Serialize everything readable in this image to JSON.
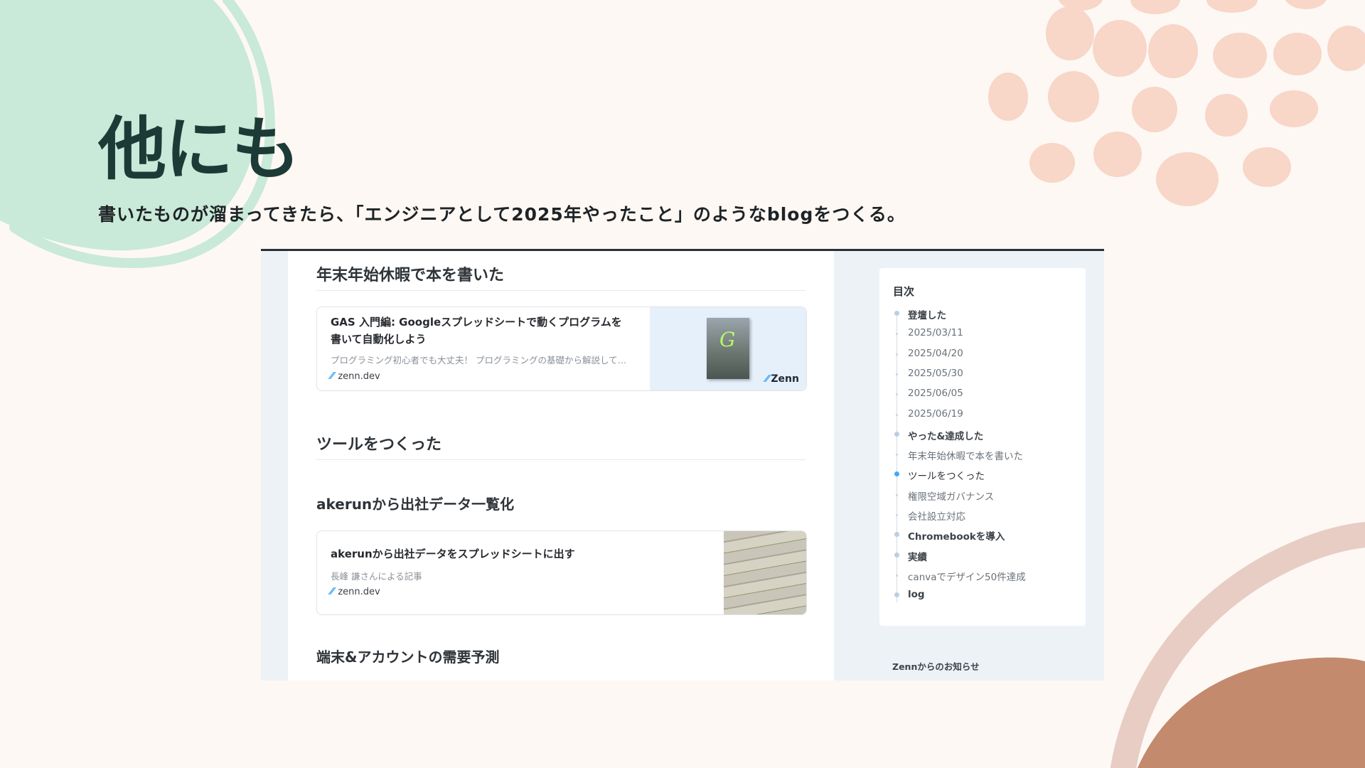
{
  "slide": {
    "title": "他にも",
    "subtitle": "書いたものが溜まってきたら、「エンジニアとして2025年やったこと」のようなblogをつくる。"
  },
  "article": {
    "section1_heading": "年末年始休暇で本を書いた",
    "card1": {
      "title_line1": "GAS 入門編: Googleスプレッドシートで動くプログラムを",
      "title_line2": "書いて自動化しよう",
      "description": "プログラミング初心者でも大丈夫！ プログラミングの基礎から解説して…",
      "domain": "zenn.dev",
      "logo_text": "Zenn",
      "thumb_letter": "G"
    },
    "section2_heading": "ツールをつくった",
    "subsection_heading": "akerunから出社データ一覧化",
    "card2": {
      "title": "akerunから出社データをスプレッドシートに出す",
      "description": "長峰 謙さんによる記事",
      "domain": "zenn.dev"
    },
    "section3_heading": "端末&アカウントの需要予測"
  },
  "toc": {
    "title": "目次",
    "items": [
      {
        "label": "登壇した",
        "level": 1
      },
      {
        "label": "2025/03/11",
        "level": 2
      },
      {
        "label": "2025/04/20",
        "level": 2
      },
      {
        "label": "2025/05/30",
        "level": 2
      },
      {
        "label": "2025/06/05",
        "level": 2
      },
      {
        "label": "2025/06/19",
        "level": 2
      },
      {
        "label": "やった&達成した",
        "level": 1
      },
      {
        "label": "年末年始休暇で本を書いた",
        "level": 2
      },
      {
        "label": "ツールをつくった",
        "level": 2,
        "active": true
      },
      {
        "label": "権限空域ガバナンス",
        "level": 2
      },
      {
        "label": "会社設立対応",
        "level": 2
      },
      {
        "label": "Chromebookを導入",
        "level": 1
      },
      {
        "label": "実績",
        "level": 1
      },
      {
        "label": "canvaでデザイン50件達成",
        "level": 2
      },
      {
        "label": "log",
        "level": 1
      }
    ]
  },
  "sidebar": {
    "news_label": "Zennからのお知らせ"
  },
  "colors": {
    "accent": "#3ea8ff",
    "slide_title": "#1d3b36",
    "mint_blob": "#c9e9d9",
    "peach_dots": "#f8d6c8",
    "clay": "#c48a6e",
    "pink_arc": "#e8cdc5"
  }
}
